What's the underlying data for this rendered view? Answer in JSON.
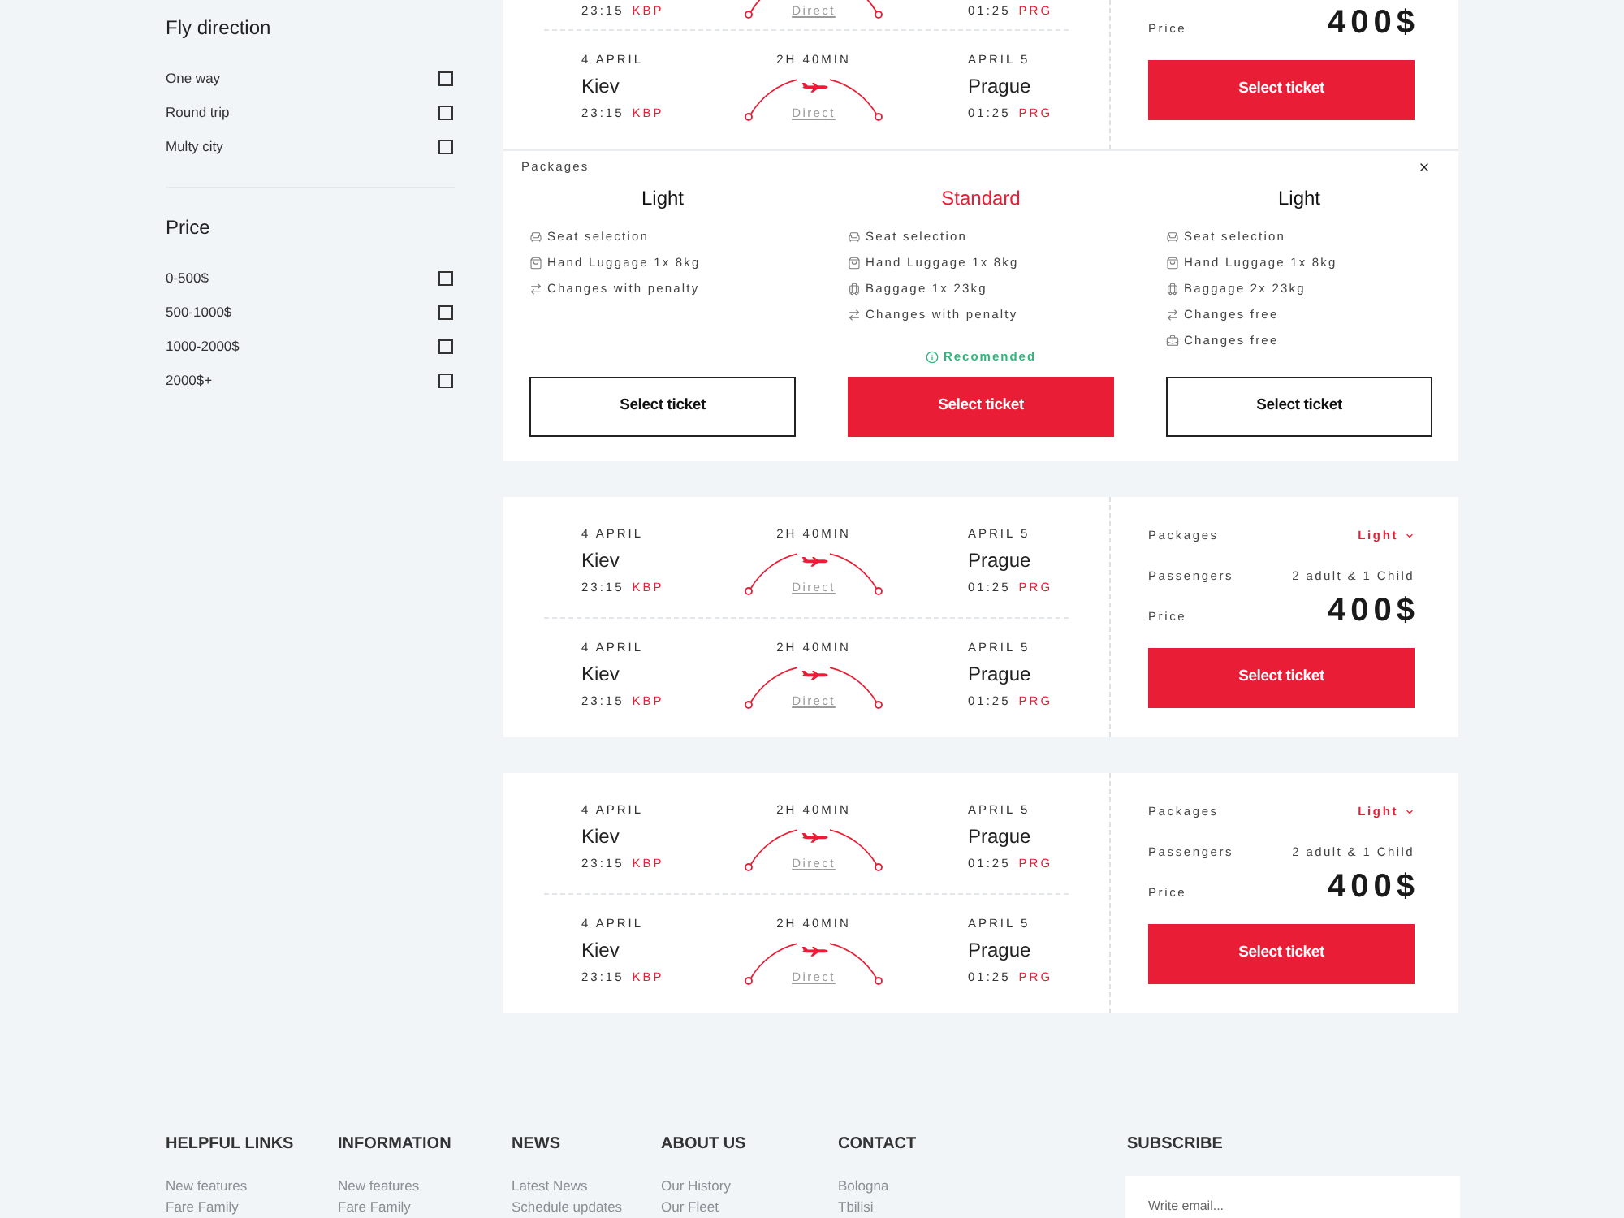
{
  "sidebar": {
    "groups": [
      {
        "title": "Fly direction",
        "options": [
          {
            "label": "One way",
            "checked": false
          },
          {
            "label": "Round trip",
            "checked": false
          },
          {
            "label": "Multy city",
            "checked": false
          }
        ]
      },
      {
        "title": "Price",
        "options": [
          {
            "label": "0-500$",
            "checked": false
          },
          {
            "label": "500-1000$",
            "checked": false
          },
          {
            "label": "1000-2000$",
            "checked": false
          },
          {
            "label": "2000$+",
            "checked": false
          }
        ]
      }
    ]
  },
  "tickets": [
    {
      "segments": [
        {
          "kind": "partial",
          "time_from": "23:15",
          "code_from": "KBP",
          "stop": "Direct",
          "time_to": "01:25",
          "code_to": "PRG"
        },
        {
          "kind": "full",
          "date_from": "4 APRIL",
          "city_from": "Kiev",
          "time_from": "23:15",
          "code_from": "KBP",
          "duration": "2H 40MIN",
          "stop": "Direct",
          "date_to": "APRIL 5",
          "city_to": "Prague",
          "time_to": "01:25",
          "code_to": "PRG"
        }
      ],
      "summary": {
        "price_label": "Price",
        "price": "400$",
        "button": "Select ticket"
      },
      "packages": {
        "label": "Packages",
        "options": [
          {
            "name": "Light",
            "selected": false,
            "features": [
              {
                "kind": "seat",
                "text": "Seat selection"
              },
              {
                "kind": "hand_luggage",
                "text": "Hand Luggage 1x 8kg"
              },
              {
                "kind": "changes",
                "text": "Changes with penalty"
              }
            ],
            "button": "Select ticket"
          },
          {
            "name": "Standard",
            "selected": true,
            "features": [
              {
                "kind": "seat",
                "text": "Seat selection"
              },
              {
                "kind": "hand_luggage",
                "text": "Hand Luggage 1x 8kg"
              },
              {
                "kind": "baggage",
                "text": "Baggage 1x 23kg"
              },
              {
                "kind": "changes",
                "text": "Changes with penalty"
              }
            ],
            "note": "Recomended",
            "button": "Select ticket"
          },
          {
            "name": "Light",
            "selected": false,
            "features": [
              {
                "kind": "seat",
                "text": "Seat selection"
              },
              {
                "kind": "hand_luggage",
                "text": "Hand Luggage 1x 8kg"
              },
              {
                "kind": "baggage",
                "text": "Baggage 2x 23kg"
              },
              {
                "kind": "changes",
                "text": "Changes free"
              },
              {
                "kind": "extras",
                "text": "Changes free"
              }
            ],
            "button": "Select ticket"
          }
        ]
      }
    },
    {
      "segments": [
        {
          "kind": "full",
          "date_from": "4 APRIL",
          "city_from": "Kiev",
          "time_from": "23:15",
          "code_from": "KBP",
          "duration": "2H 40MIN",
          "stop": "Direct",
          "date_to": "APRIL 5",
          "city_to": "Prague",
          "time_to": "01:25",
          "code_to": "PRG"
        },
        {
          "kind": "full",
          "date_from": "4 APRIL",
          "city_from": "Kiev",
          "time_from": "23:15",
          "code_from": "KBP",
          "duration": "2H 40MIN",
          "stop": "Direct",
          "date_to": "APRIL 5",
          "city_to": "Prague",
          "time_to": "01:25",
          "code_to": "PRG"
        }
      ],
      "summary": {
        "packages_label": "Packages",
        "package": "Light",
        "passengers_label": "Passengers",
        "passengers": "2 adult & 1 Child",
        "price_label": "Price",
        "price": "400$",
        "button": "Select ticket"
      }
    },
    {
      "segments": [
        {
          "kind": "full",
          "date_from": "4 APRIL",
          "city_from": "Kiev",
          "time_from": "23:15",
          "code_from": "KBP",
          "duration": "2H 40MIN",
          "stop": "Direct",
          "date_to": "APRIL 5",
          "city_to": "Prague",
          "time_to": "01:25",
          "code_to": "PRG"
        },
        {
          "kind": "full",
          "date_from": "4 APRIL",
          "city_from": "Kiev",
          "time_from": "23:15",
          "code_from": "KBP",
          "duration": "2H 40MIN",
          "stop": "Direct",
          "date_to": "APRIL 5",
          "city_to": "Prague",
          "time_to": "01:25",
          "code_to": "PRG"
        }
      ],
      "summary": {
        "packages_label": "Packages",
        "package": "Light",
        "passengers_label": "Passengers",
        "passengers": "2 adult & 1 Child",
        "price_label": "Price",
        "price": "400$",
        "button": "Select ticket"
      }
    }
  ],
  "footer": {
    "columns": [
      {
        "title": "HELPFUL LINKS",
        "links": [
          "New features",
          "Fare Family"
        ]
      },
      {
        "title": "INFORMATION",
        "links": [
          "New features",
          "Fare Family"
        ]
      },
      {
        "title": "NEWS",
        "links": [
          "Latest News",
          "Schedule updates"
        ]
      },
      {
        "title": "ABOUT US",
        "links": [
          "Our History",
          "Our Fleet"
        ]
      },
      {
        "title": "CONTACT",
        "links": [
          "Bologna",
          "Tbilisi"
        ]
      }
    ],
    "subscribe": {
      "title": "SUBSCRIBE",
      "placeholder": "Write email..."
    }
  }
}
